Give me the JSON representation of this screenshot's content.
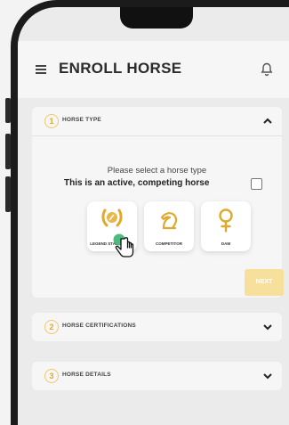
{
  "app": {
    "title": "ENROLL HORSE"
  },
  "sections": [
    {
      "number": "1",
      "label": "HORSE TYPE",
      "expanded": true
    },
    {
      "number": "2",
      "label": "HORSE CERTIFICATIONS",
      "expanded": false
    },
    {
      "number": "3",
      "label": "HORSE DETAILS",
      "expanded": false
    }
  ],
  "horse_type": {
    "prompt": "Please select a horse type",
    "active_label": "This is an active, competing horse",
    "active_checked": false,
    "options": [
      {
        "label": "LEGEND STAL",
        "icon": "laurel-horse-icon",
        "selected": true
      },
      {
        "label": "COMPETITOR",
        "icon": "horse-head-icon",
        "selected": false
      },
      {
        "label": "DAM",
        "icon": "female-symbol-icon",
        "selected": false
      }
    ],
    "next_label": "NEXT"
  },
  "colors": {
    "accent": "#e0a92a",
    "accent_light": "#f7df9c",
    "selection": "#3cb371"
  }
}
